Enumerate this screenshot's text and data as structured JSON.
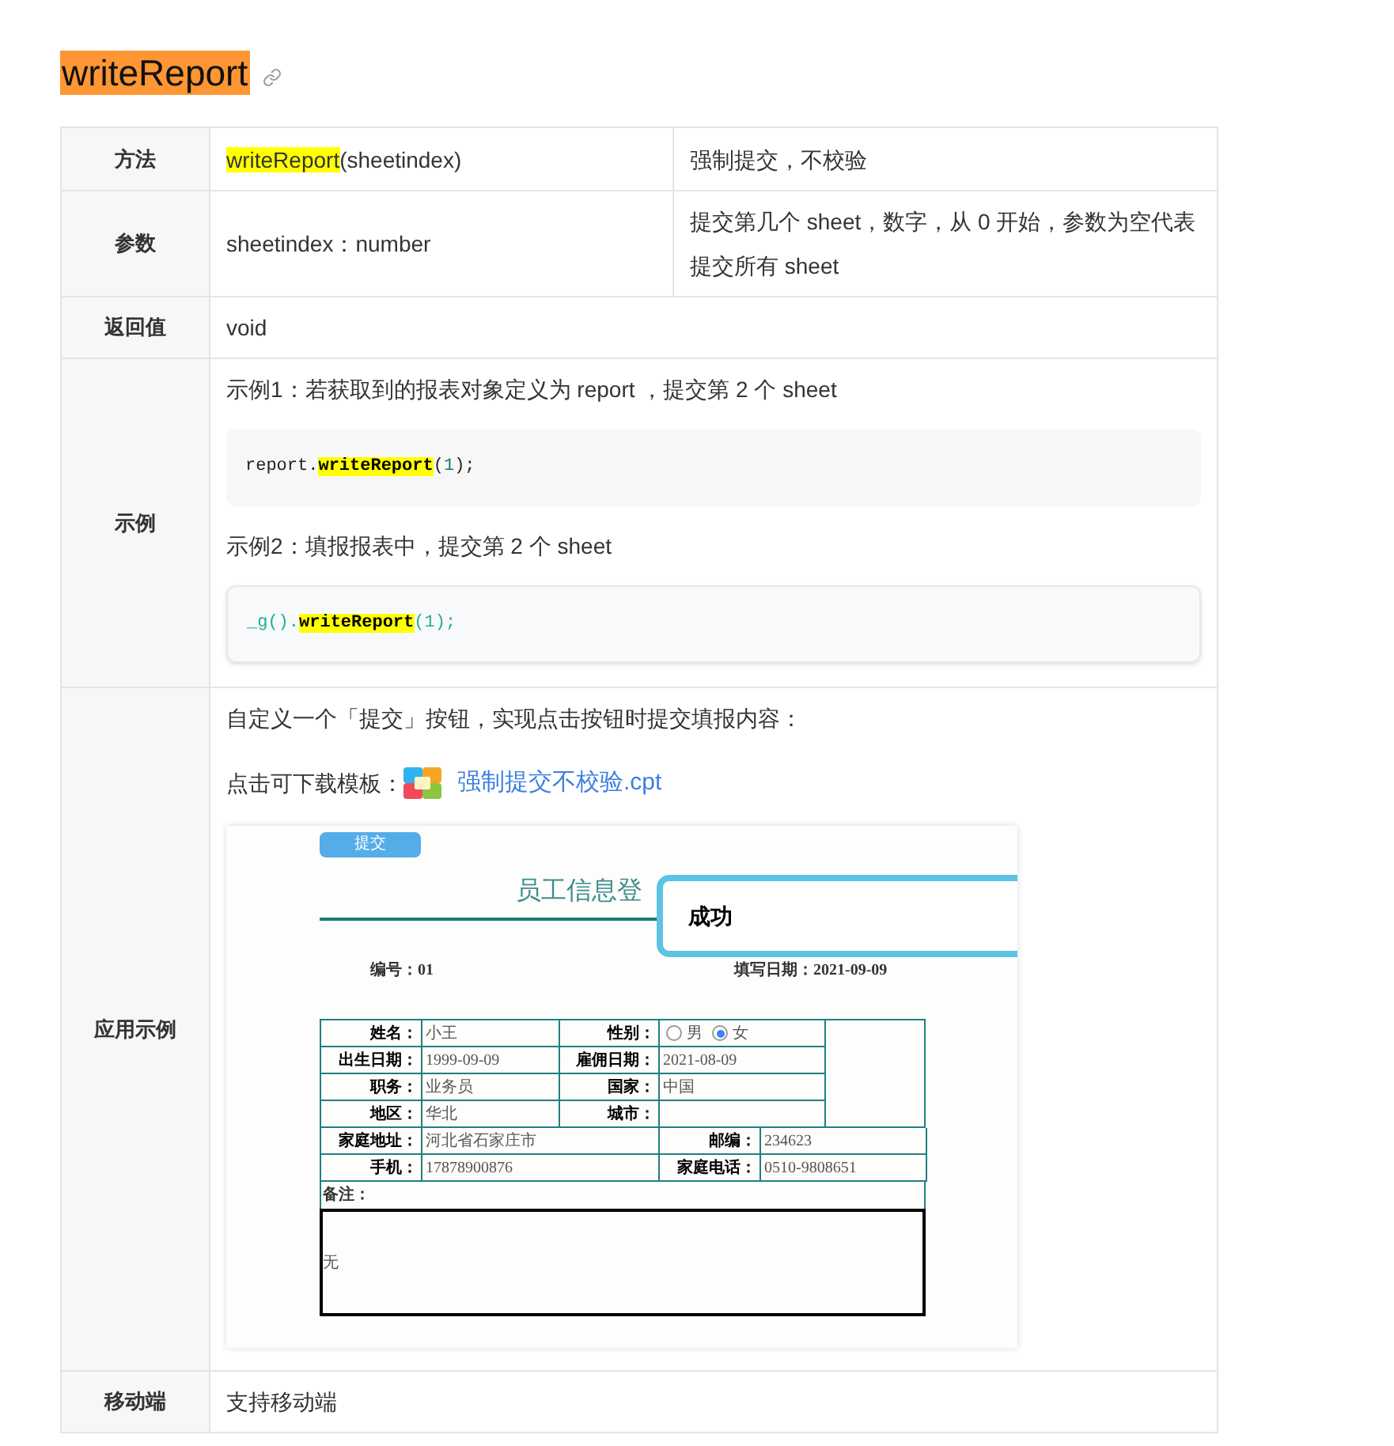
{
  "title": "writeReport",
  "table": {
    "rows": [
      {
        "kind": "split",
        "label": "方法",
        "cells": [
          [
            {
              "text": "writeReport",
              "highlight": true
            },
            {
              "text": "(sheetindex)",
              "highlight": false
            }
          ],
          [
            {
              "text": "强制提交，不校验",
              "highlight": false
            }
          ]
        ]
      },
      {
        "kind": "split",
        "label": "参数",
        "cells": [
          [
            {
              "text": "sheetindex：number",
              "highlight": false
            }
          ],
          [
            {
              "text": "提交第几个 sheet，数字，从 0 开始，参数为空代表提交所有 sheet",
              "highlight": false
            }
          ]
        ]
      },
      {
        "kind": "text",
        "label": "返回值",
        "value": "void"
      },
      {
        "kind": "examples",
        "label": "示例",
        "items": [
          {
            "kind": "text",
            "text": "示例1：若获取到的报表对象定义为 report ，提交第 2 个 sheet"
          },
          {
            "kind": "code",
            "tokens": [
              {
                "text": "report.",
                "kind": "ident"
              },
              {
                "text": "writeReport",
                "kind": "highlight"
              },
              {
                "text": "(",
                "kind": "punct"
              },
              {
                "text": "1",
                "kind": "number"
              },
              {
                "text": ");",
                "kind": "punct"
              }
            ]
          },
          {
            "kind": "text",
            "text": "示例2：填报报表中，提交第 2 个 sheet"
          },
          {
            "kind": "code_tinted",
            "tokens": [
              {
                "text": "_g().",
                "kind": "ident"
              },
              {
                "text": "writeReport",
                "kind": "highlight"
              },
              {
                "text": "(1);",
                "kind": "punct"
              }
            ]
          }
        ]
      },
      {
        "kind": "demo",
        "label": "应用示例",
        "intro": "自定义一个「提交」按钮，实现点击按钮时提交填报内容：",
        "download_label": "点击可下载模板：",
        "download_link": "强制提交不校验.cpt",
        "screenshot": {
          "submit_button": "提交",
          "heading": "员工信息登",
          "popup": "成功",
          "number": "编号：01",
          "date": "填写日期：2021-09-09",
          "top_rows": [
            {
              "left": {
                "label": "姓名：",
                "value": "小王"
              },
              "right": {
                "label": "性别：",
                "options": [
                  {
                    "label": "男",
                    "selected": false
                  },
                  {
                    "label": "女",
                    "selected": true
                  }
                ]
              }
            },
            {
              "left": {
                "label": "出生日期：",
                "value": "1999-09-09"
              },
              "right": {
                "label": "雇佣日期：",
                "value": "2021-08-09"
              }
            },
            {
              "left": {
                "label": "职务：",
                "value": "业务员"
              },
              "right": {
                "label": "国家：",
                "value": "中国"
              }
            },
            {
              "left": {
                "label": "地区：",
                "value": "华北"
              },
              "right": {
                "label": "城市："
              }
            }
          ],
          "bottom_rows": [
            {
              "left": {
                "label": "家庭地址：",
                "value": "河北省石家庄市"
              },
              "right": {
                "label": "邮编：",
                "value": "234623"
              }
            },
            {
              "left": {
                "label": "手机：",
                "value": "17878900876"
              },
              "right": {
                "label": "家庭电话：",
                "value": "0510-9808651"
              }
            }
          ],
          "remarks": {
            "label": "备注：",
            "value": "无"
          }
        }
      },
      {
        "kind": "text",
        "label": "移动端",
        "value": "支持移动端"
      }
    ]
  }
}
